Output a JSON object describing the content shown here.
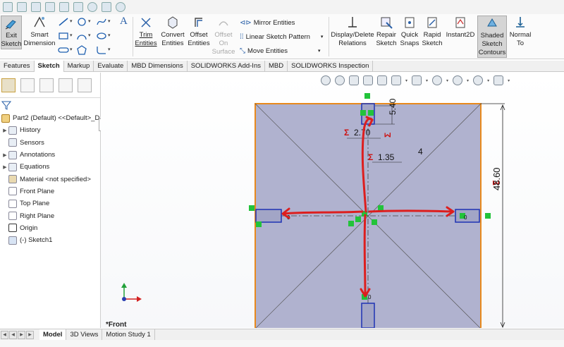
{
  "ribbon": {
    "exit_sketch": "Exit\nSketch",
    "smart_dimension": "Smart\nDimension",
    "trim_entities": "Trim\nEntities",
    "convert_entities": "Convert\nEntities",
    "offset_entities": "Offset\nEntities",
    "offset_on_surface": "Offset\nOn\nSurface",
    "mirror_entities": "Mirror Entities",
    "linear_sketch_pattern": "Linear Sketch Pattern",
    "move_entities": "Move Entities",
    "display_delete_relations": "Display/Delete\nRelations",
    "repair_sketch": "Repair\nSketch",
    "quick_snaps": "Quick\nSnaps",
    "rapid_sketch": "Rapid\nSketch",
    "instant2d": "Instant2D",
    "shaded_sketch_contours": "Shaded\nSketch\nContours",
    "normal_to": "Normal\nTo"
  },
  "tabs": [
    "Features",
    "Sketch",
    "Markup",
    "Evaluate",
    "MBD Dimensions",
    "SOLIDWORKS Add-Ins",
    "MBD",
    "SOLIDWORKS Inspection"
  ],
  "active_tab": "Sketch",
  "tree": {
    "root": "Part2 (Default) <<Default>_D",
    "items": [
      {
        "label": "History",
        "expandable": true,
        "icon": "history-icon"
      },
      {
        "label": "Sensors",
        "expandable": false,
        "icon": "sensors-icon"
      },
      {
        "label": "Annotations",
        "expandable": true,
        "icon": "annotations-icon"
      },
      {
        "label": "Equations",
        "expandable": true,
        "icon": "equations-icon"
      },
      {
        "label": "Material <not specified>",
        "expandable": false,
        "icon": "material-icon"
      },
      {
        "label": "Front Plane",
        "expandable": false,
        "icon": "plane-icon"
      },
      {
        "label": "Top Plane",
        "expandable": false,
        "icon": "plane-icon"
      },
      {
        "label": "Right Plane",
        "expandable": false,
        "icon": "plane-icon"
      },
      {
        "label": "Origin",
        "expandable": false,
        "icon": "origin-icon"
      },
      {
        "label": "(-) Sketch1",
        "expandable": false,
        "icon": "sketch-icon"
      }
    ]
  },
  "sketch": {
    "dim_overall": "48.60",
    "dim_top_width": "2.70",
    "dim_top_height": "5.40",
    "dim_offset": "1.35",
    "relation_label": "4",
    "small_zero_label": "0",
    "equation_symbol": "Σ"
  },
  "view_name": "*Front",
  "bottom_tabs": [
    "Model",
    "3D Views",
    "Motion Study 1"
  ],
  "active_bottom_tab": "Model",
  "colors": {
    "plate_fill": "#b0b2cf",
    "plate_edge": "#e8891c",
    "sketch_blue": "#1e32b4",
    "dimension_red": "#cc1111",
    "relation_green": "#22c33a",
    "annotation_red": "#dd1e1e"
  }
}
